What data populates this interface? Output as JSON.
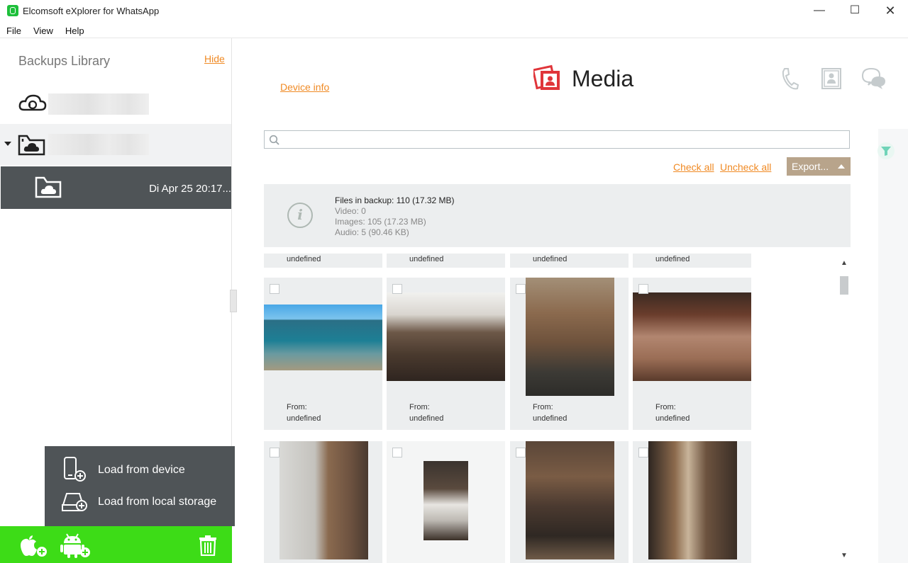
{
  "window": {
    "title": "Elcomsoft eXplorer for WhatsApp",
    "controls": {
      "minimize": "—",
      "maximize": "☐",
      "close": "✕"
    }
  },
  "menu": [
    "File",
    "View",
    "Help"
  ],
  "sidebar": {
    "title": "Backups Library",
    "hide_label": "Hide",
    "sources": [
      {
        "icon": "cloud-backup-icon",
        "name": ""
      },
      {
        "icon": "folder-cloud-icon",
        "name": ""
      }
    ],
    "selected_backup": {
      "icon": "folder-cloud-icon",
      "date": "Di Apr 25 20:17..."
    },
    "load_menu": {
      "items": [
        {
          "icon": "device-add-icon",
          "label": "Load from device"
        },
        {
          "icon": "storage-add-icon",
          "label": "Load from local storage"
        }
      ]
    },
    "bottom_bar": {
      "accent": "#3ddc17",
      "buttons": [
        "apple-add-icon",
        "android-add-icon",
        "trash-icon"
      ]
    }
  },
  "main": {
    "device_info_link": "Device info",
    "section_title": "Media",
    "header_icons": [
      "phone-icon",
      "contacts-icon",
      "chat-icon"
    ],
    "search": {
      "value": "",
      "placeholder": ""
    },
    "check_all": "Check all",
    "uncheck_all": "Uncheck all",
    "export_label": "Export...",
    "info": {
      "files_in_backup": "Files in backup: 110 (17.32 MB)",
      "video": "Video: 0",
      "images": "Images: 105 (17.23 MB)",
      "audio": "Audio: 5 (90.46 KB)"
    },
    "top_partial_tiles": [
      "undefined",
      "undefined",
      "undefined",
      "undefined"
    ],
    "tiles": [
      {
        "from_label": "From:",
        "from_value": "undefined",
        "photo": "beach pier"
      },
      {
        "from_label": "From:",
        "from_value": "undefined",
        "photo": "flattened boxes on table"
      },
      {
        "from_label": "From:",
        "from_value": "undefined",
        "photo": "boxes in storage room"
      },
      {
        "from_label": "From:",
        "from_value": "undefined",
        "photo": "stacked moving boxes"
      },
      {
        "photo": "boxes against wall"
      },
      {
        "photo": "open doorway"
      },
      {
        "photo": "cluttered boxes"
      },
      {
        "photo": "ladder in storage room"
      }
    ],
    "colors": {
      "accent": "#f08a24",
      "media_icon": "#e0353a",
      "filter": "#6fd4b8"
    }
  }
}
